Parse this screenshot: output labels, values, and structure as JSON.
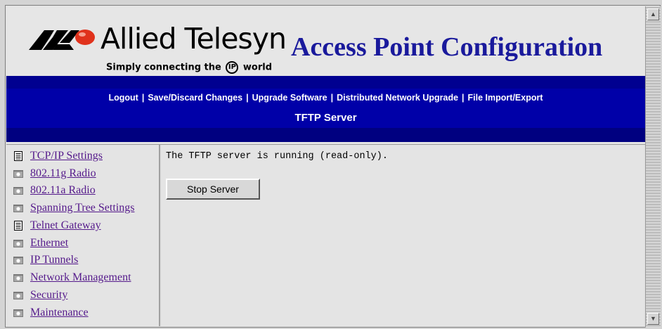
{
  "header": {
    "brand_name": "Allied Telesyn",
    "tagline_before": "Simply connecting the",
    "tagline_ip": "IP",
    "tagline_after": "world",
    "title": "Access Point Configuration"
  },
  "nav": {
    "links": [
      "Logout",
      "Save/Discard Changes",
      "Upgrade Software",
      "Distributed Network Upgrade",
      "File Import/Export"
    ],
    "section_title": "TFTP Server"
  },
  "sidebar": {
    "items": [
      {
        "label": "TCP/IP Settings",
        "icon": "document-icon"
      },
      {
        "label": "802.11g Radio",
        "icon": "folder-icon"
      },
      {
        "label": "802.11a Radio",
        "icon": "folder-icon"
      },
      {
        "label": "Spanning Tree Settings",
        "icon": "folder-icon"
      },
      {
        "label": "Telnet Gateway",
        "icon": "document-icon"
      },
      {
        "label": "Ethernet",
        "icon": "folder-icon"
      },
      {
        "label": "IP Tunnels",
        "icon": "folder-icon"
      },
      {
        "label": "Network Management",
        "icon": "folder-icon"
      },
      {
        "label": "Security",
        "icon": "folder-icon"
      },
      {
        "label": "Maintenance",
        "icon": "folder-icon"
      }
    ]
  },
  "content": {
    "status_text": "The TFTP server is running (read-only).",
    "stop_button_label": "Stop Server"
  },
  "colors": {
    "nav_background": "#0000a8",
    "title_blue": "#1a1a9c",
    "link_visited": "#551a8b"
  }
}
